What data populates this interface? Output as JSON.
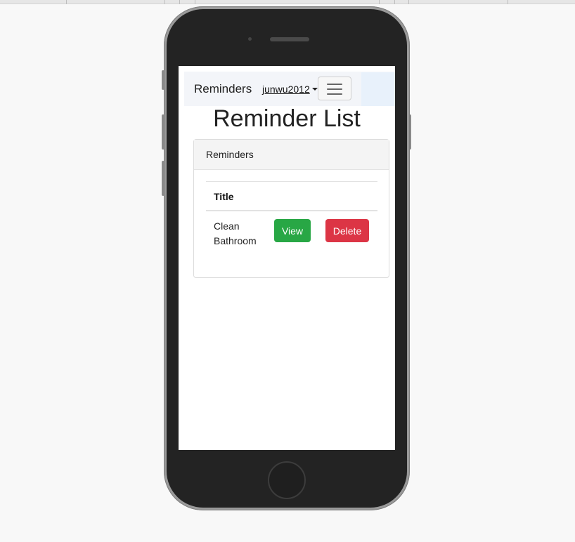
{
  "navbar": {
    "brand": "Reminders",
    "user": "junwu2012",
    "toggler_icon": "hamburger-icon"
  },
  "page": {
    "title": "Reminder List"
  },
  "card": {
    "header": "Reminders",
    "table": {
      "columns": [
        "Title"
      ],
      "rows": [
        {
          "title": "Clean Bathroom",
          "view_label": "View",
          "delete_label": "Delete"
        }
      ]
    }
  },
  "colors": {
    "view_button": "#28a745",
    "delete_button": "#dc3545",
    "navbar_bg": "#f3f5f9"
  }
}
